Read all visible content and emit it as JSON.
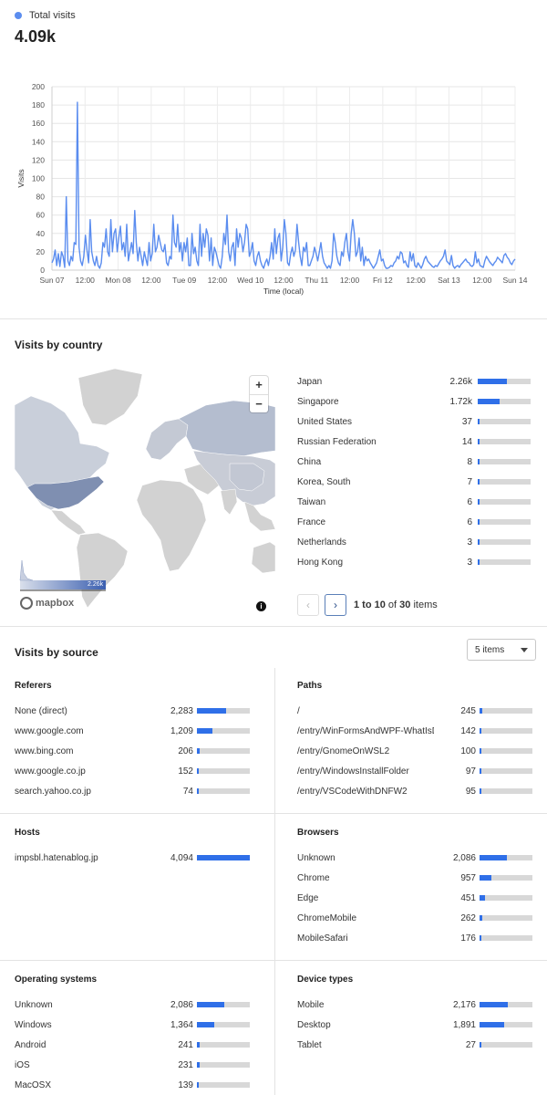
{
  "total_visits": {
    "legend_label": "Total visits",
    "legend_color": "#5b8def",
    "value": "4.09k"
  },
  "chart_data": {
    "type": "line",
    "ylabel": "Visits",
    "xlabel": "Time (local)",
    "ylim": [
      0,
      200
    ],
    "yticks": [
      0,
      20,
      40,
      60,
      80,
      100,
      120,
      140,
      160,
      180,
      200
    ],
    "xtick_labels": [
      "Sun 07",
      "12:00",
      "Mon 08",
      "12:00",
      "Tue 09",
      "12:00",
      "Wed 10",
      "12:00",
      "Thu 11",
      "12:00",
      "Fri 12",
      "12:00",
      "Sat 13",
      "12:00",
      "Sun 14"
    ],
    "grid": true,
    "series": [
      {
        "color": "#5b8def",
        "values": [
          8,
          12,
          22,
          5,
          18,
          4,
          20,
          15,
          3,
          80,
          10,
          5,
          15,
          10,
          30,
          28,
          183,
          25,
          10,
          5,
          15,
          38,
          22,
          8,
          55,
          20,
          10,
          5,
          15,
          5,
          2,
          8,
          30,
          25,
          45,
          20,
          15,
          55,
          20,
          40,
          45,
          20,
          35,
          48,
          22,
          30,
          15,
          50,
          10,
          20,
          30,
          18,
          65,
          30,
          10,
          25,
          15,
          5,
          20,
          12,
          5,
          30,
          10,
          18,
          50,
          20,
          25,
          38,
          30,
          22,
          20,
          28,
          8,
          5,
          15,
          12,
          60,
          30,
          25,
          50,
          20,
          30,
          10,
          30,
          20,
          35,
          5,
          5,
          40,
          18,
          25,
          10,
          5,
          50,
          15,
          40,
          25,
          45,
          38,
          10,
          35,
          5,
          25,
          20,
          12,
          5,
          2,
          15,
          40,
          28,
          60,
          20,
          10,
          25,
          30,
          5,
          45,
          25,
          40,
          35,
          20,
          30,
          50,
          45,
          15,
          20,
          30,
          10,
          5,
          15,
          20,
          10,
          5,
          2,
          8,
          12,
          5,
          15,
          30,
          12,
          45,
          18,
          35,
          40,
          10,
          25,
          55,
          40,
          8,
          5,
          18,
          25,
          15,
          22,
          50,
          30,
          15,
          5,
          25,
          20,
          30,
          5,
          5,
          10,
          15,
          25,
          18,
          10,
          20,
          30,
          15,
          8,
          5,
          2,
          5,
          2,
          10,
          40,
          30,
          15,
          8,
          5,
          20,
          15,
          30,
          40,
          20,
          10,
          40,
          55,
          40,
          15,
          20,
          35,
          10,
          25,
          5,
          15,
          10,
          12,
          8,
          5,
          2,
          5,
          8,
          15,
          22,
          10,
          12,
          5,
          2,
          2,
          3,
          5,
          4,
          8,
          10,
          15,
          12,
          20,
          18,
          8,
          10,
          5,
          3,
          20,
          10,
          18,
          5,
          3,
          8,
          5,
          2,
          6,
          12,
          15,
          10,
          8,
          6,
          4,
          3,
          5,
          4,
          7,
          10,
          12,
          15,
          22,
          10,
          8,
          6,
          16,
          5,
          2,
          4,
          5,
          3,
          6,
          8,
          10,
          12,
          9,
          8,
          5,
          4,
          6,
          20,
          8,
          12,
          5,
          4,
          3,
          10,
          15,
          12,
          9,
          7,
          5,
          8,
          10,
          14,
          12,
          10,
          8,
          16,
          18,
          14,
          12,
          8,
          6,
          10,
          12
        ]
      }
    ]
  },
  "countries_section": {
    "title": "Visits by country",
    "map_legend_max": "2.26k",
    "mapbox_label": "mapbox",
    "zoom_in": "+",
    "zoom_out": "−",
    "info_icon": "i",
    "rows": [
      {
        "name": "Japan",
        "value": "2.26k",
        "ratio": 0.55
      },
      {
        "name": "Singapore",
        "value": "1.72k",
        "ratio": 0.42
      },
      {
        "name": "United States",
        "value": "37",
        "ratio": 0.012
      },
      {
        "name": "Russian Federation",
        "value": "14",
        "ratio": 0.008
      },
      {
        "name": "China",
        "value": "8",
        "ratio": 0.006
      },
      {
        "name": "Korea, South",
        "value": "7",
        "ratio": 0.006
      },
      {
        "name": "Taiwan",
        "value": "6",
        "ratio": 0.005
      },
      {
        "name": "France",
        "value": "6",
        "ratio": 0.005
      },
      {
        "name": "Netherlands",
        "value": "3",
        "ratio": 0.004
      },
      {
        "name": "Hong Kong",
        "value": "3",
        "ratio": 0.004
      }
    ],
    "pager": {
      "prev": "‹",
      "next": "›",
      "range": "1 to 10",
      "of": "of",
      "total": "30",
      "unit": "items"
    }
  },
  "source_section": {
    "title": "Visits by source",
    "select_value": "5 items",
    "panels": {
      "referers": {
        "title": "Referers",
        "rows": [
          {
            "name": "None (direct)",
            "value": "2,283",
            "ratio": 0.56
          },
          {
            "name": "www.google.com",
            "value": "1,209",
            "ratio": 0.29
          },
          {
            "name": "www.bing.com",
            "value": "206",
            "ratio": 0.05
          },
          {
            "name": "www.google.co.jp",
            "value": "152",
            "ratio": 0.04
          },
          {
            "name": "search.yahoo.co.jp",
            "value": "74",
            "ratio": 0.02
          }
        ]
      },
      "paths": {
        "title": "Paths",
        "rows": [
          {
            "name": "/",
            "value": "245",
            "ratio": 0.06
          },
          {
            "name": "/entry/WinFormsAndWPF-WhatIsDi...",
            "value": "142",
            "ratio": 0.035
          },
          {
            "name": "/entry/GnomeOnWSL2",
            "value": "100",
            "ratio": 0.025
          },
          {
            "name": "/entry/WindowsInstallFolder",
            "value": "97",
            "ratio": 0.024
          },
          {
            "name": "/entry/VSCodeWithDNFW2",
            "value": "95",
            "ratio": 0.023
          }
        ]
      },
      "hosts": {
        "title": "Hosts",
        "rows": [
          {
            "name": "impsbl.hatenablog.jp",
            "value": "4,094",
            "ratio": 1.0
          }
        ]
      },
      "browsers": {
        "title": "Browsers",
        "rows": [
          {
            "name": "Unknown",
            "value": "2,086",
            "ratio": 0.51
          },
          {
            "name": "Chrome",
            "value": "957",
            "ratio": 0.23
          },
          {
            "name": "Edge",
            "value": "451",
            "ratio": 0.11
          },
          {
            "name": "ChromeMobile",
            "value": "262",
            "ratio": 0.06
          },
          {
            "name": "MobileSafari",
            "value": "176",
            "ratio": 0.04
          }
        ]
      },
      "os": {
        "title": "Operating systems",
        "rows": [
          {
            "name": "Unknown",
            "value": "2,086",
            "ratio": 0.51
          },
          {
            "name": "Windows",
            "value": "1,364",
            "ratio": 0.33
          },
          {
            "name": "Android",
            "value": "241",
            "ratio": 0.06
          },
          {
            "name": "iOS",
            "value": "231",
            "ratio": 0.056
          },
          {
            "name": "MacOSX",
            "value": "139",
            "ratio": 0.034
          }
        ]
      },
      "devices": {
        "title": "Device types",
        "rows": [
          {
            "name": "Mobile",
            "value": "2,176",
            "ratio": 0.53
          },
          {
            "name": "Desktop",
            "value": "1,891",
            "ratio": 0.46
          },
          {
            "name": "Tablet",
            "value": "27",
            "ratio": 0.007
          }
        ]
      }
    }
  },
  "colors": {
    "bar_fill": "#2f6fe8",
    "bar_track": "#d8d8d8",
    "map_land": "#d2d2d2",
    "map_highlight": "#a9b6cf"
  }
}
